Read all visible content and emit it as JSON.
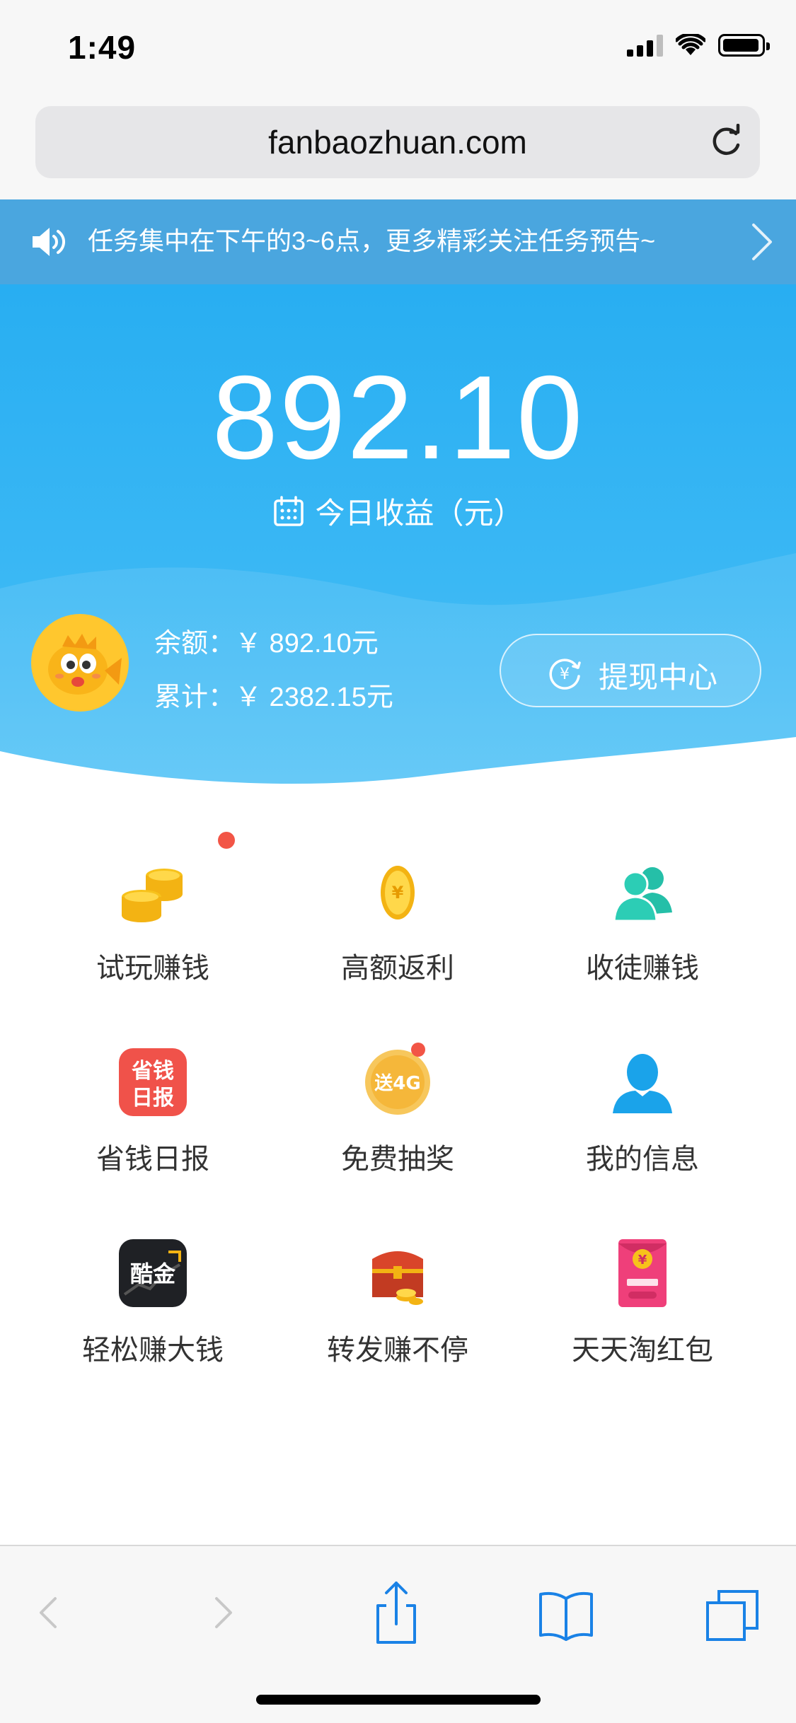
{
  "status": {
    "time": "1:49",
    "icons": [
      "signal-icon",
      "wifi-icon",
      "battery-icon"
    ]
  },
  "browser": {
    "url": "fanbaozhuan.com",
    "reload_icon": "reload-icon"
  },
  "notice": {
    "text": "任务集中在下午的3~6点，更多精彩关注任务预告~",
    "icon": "speaker-icon"
  },
  "hero": {
    "amount": "892.10",
    "label": "今日收益（元）",
    "balance": "余额：￥ 892.10元",
    "total": "累计：￥ 2382.15元",
    "withdraw_label": "提现中心"
  },
  "menu": {
    "items": [
      {
        "label": "试玩赚钱",
        "icon": "coins-stack-icon",
        "badge": true
      },
      {
        "label": "高额返利",
        "icon": "gold-coin-icon",
        "badge": false
      },
      {
        "label": "收徒赚钱",
        "icon": "people-icon",
        "badge": false
      },
      {
        "label": "省钱日报",
        "icon": "daily-report-icon",
        "icon_text": "省钱日报",
        "badge": false
      },
      {
        "label": "免费抽奖",
        "icon": "lottery-icon",
        "icon_text": "送4G",
        "badge": true
      },
      {
        "label": "我的信息",
        "icon": "user-icon",
        "badge": false
      },
      {
        "label": "轻松赚大钱",
        "icon": "kujin-app-icon",
        "icon_text": "酷金",
        "badge": false
      },
      {
        "label": "转发赚不停",
        "icon": "treasure-chest-icon",
        "badge": false
      },
      {
        "label": "天天淘红包",
        "icon": "red-packet-icon",
        "badge": false
      }
    ]
  },
  "toolbar": {
    "items": [
      "back-icon",
      "forward-icon",
      "share-icon",
      "bookmarks-icon",
      "tabs-icon"
    ]
  },
  "colors": {
    "accent": "#28aef2",
    "notice_bg": "#4aa6df",
    "badge": "#f25546"
  }
}
